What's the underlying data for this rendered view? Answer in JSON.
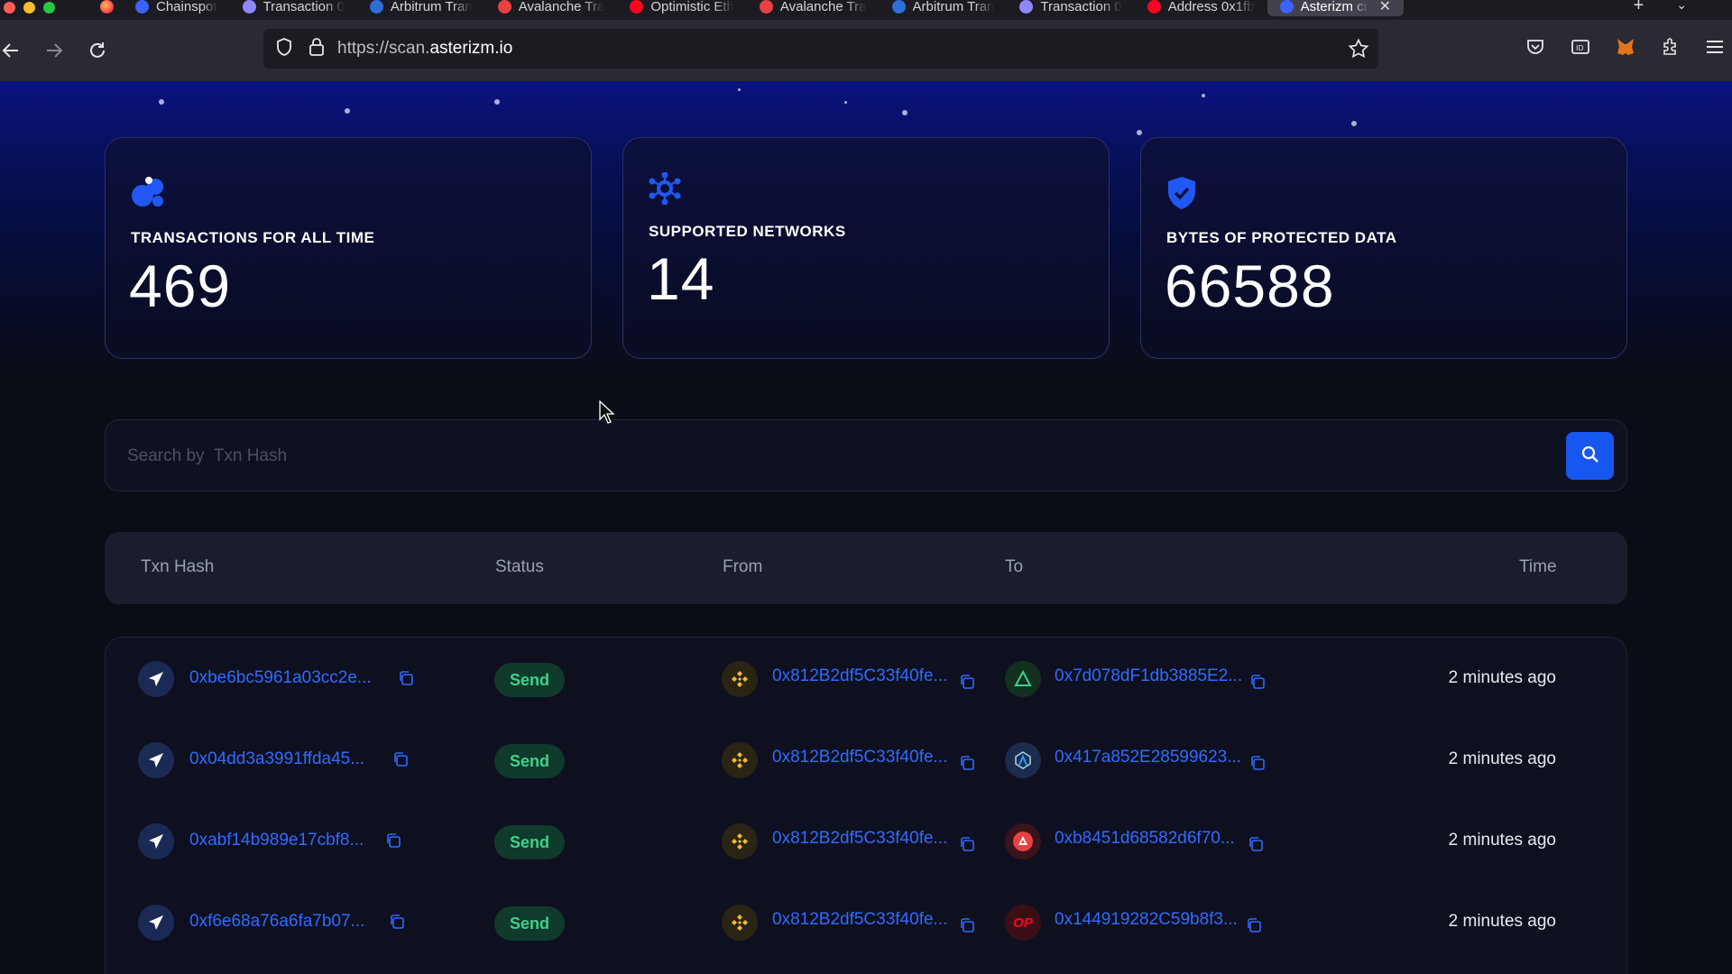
{
  "browser": {
    "tabs": [
      {
        "label": "Chainspot",
        "icon_color": "#3b63ff"
      },
      {
        "label": "Transaction 0",
        "icon_color": "#8f87ff"
      },
      {
        "label": "Arbitrum Tran",
        "icon_color": "#2d6fd6"
      },
      {
        "label": "Avalanche Tra",
        "icon_color": "#e84142"
      },
      {
        "label": "Optimistic Eth",
        "icon_color": "#ff0420"
      },
      {
        "label": "Avalanche Tra",
        "icon_color": "#e84142"
      },
      {
        "label": "Arbitrum Tran",
        "icon_color": "#2d6fd6"
      },
      {
        "label": "Transaction 0",
        "icon_color": "#8f87ff"
      },
      {
        "label": "Address 0x1fb",
        "icon_color": "#ff0420"
      },
      {
        "label": "Asterizm cr",
        "icon_color": "#3b63ff",
        "active": true
      }
    ],
    "url_prefix": "https://scan.",
    "url_domain": "asterizm.io"
  },
  "stats": [
    {
      "label": "TRANSACTIONS FOR ALL TIME",
      "value": "469"
    },
    {
      "label": "SUPPORTED NETWORKS",
      "value": "14"
    },
    {
      "label": "BYTES OF PROTECTED DATA",
      "value": "66588"
    }
  ],
  "search": {
    "placeholder": "Search by  Txn Hash",
    "value": ""
  },
  "table": {
    "headers": {
      "hash": "Txn Hash",
      "status": "Status",
      "from": "From",
      "to": "To",
      "time": "Time"
    },
    "rows": [
      {
        "hash": "0xbe6bc5961a03cc2e...",
        "status": "Send",
        "from": "0x812B2df5C33f40fe...",
        "from_chain": "bnb",
        "to": "0x7d078dF1db3885E2...",
        "to_chain": "gnosis",
        "time": "2 minutes ago"
      },
      {
        "hash": "0x04dd3a3991ffda45...",
        "status": "Send",
        "from": "0x812B2df5C33f40fe...",
        "from_chain": "bnb",
        "to": "0x417a852E28599623...",
        "to_chain": "arbitrum",
        "time": "2 minutes ago"
      },
      {
        "hash": "0xabf14b989e17cbf8...",
        "status": "Send",
        "from": "0x812B2df5C33f40fe...",
        "from_chain": "bnb",
        "to": "0xb8451d68582d6f70...",
        "to_chain": "avalanche",
        "time": "2 minutes ago"
      },
      {
        "hash": "0xf6e68a76a6fa7b07...",
        "status": "Send",
        "from": "0x812B2df5C33f40fe...",
        "from_chain": "bnb",
        "to": "0x144919282C59b8f3...",
        "to_chain": "optimism",
        "to_chain_text": "OP",
        "time": "2 minutes ago"
      }
    ]
  },
  "colors": {
    "accent": "#2f6bff",
    "send_green": "#3fd18a",
    "search_button": "#1856f0"
  }
}
